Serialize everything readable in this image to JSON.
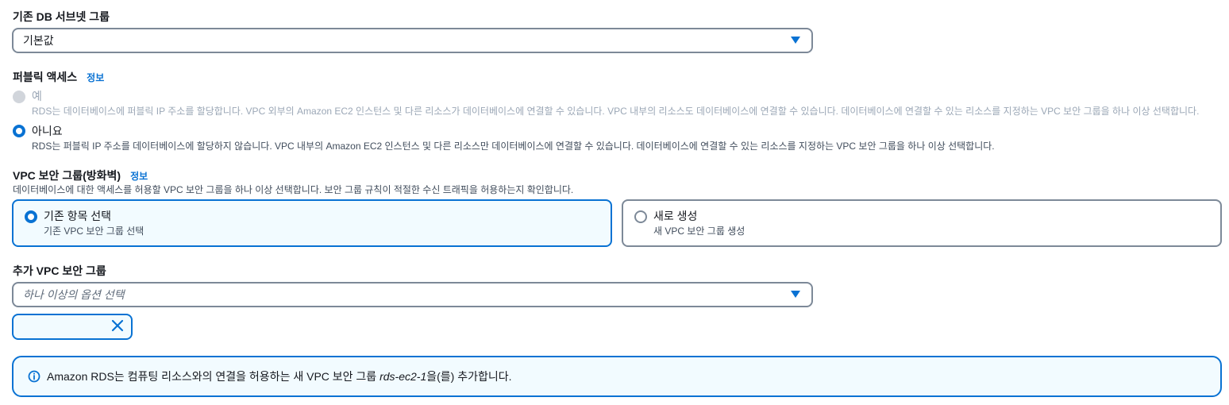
{
  "subnet_group": {
    "label": "기존 DB 서브넷 그룹",
    "value": "기본값"
  },
  "public_access": {
    "label": "퍼블릭 액세스",
    "info": "정보",
    "options": [
      {
        "label": "예",
        "description": "RDS는 데이터베이스에 퍼블릭 IP 주소를 할당합니다. VPC 외부의 Amazon EC2 인스턴스 및 다른 리소스가 데이터베이스에 연결할 수 있습니다. VPC 내부의 리소스도 데이터베이스에 연결할 수 있습니다. 데이터베이스에 연결할 수 있는 리소스를 지정하는 VPC 보안 그룹을 하나 이상 선택합니다.",
        "disabled": true
      },
      {
        "label": "아니요",
        "description": "RDS는 퍼블릭 IP 주소를 데이터베이스에 할당하지 않습니다. VPC 내부의 Amazon EC2 인스턴스 및 다른 리소스만 데이터베이스에 연결할 수 있습니다. 데이터베이스에 연결할 수 있는 리소스를 지정하는 VPC 보안 그룹을 하나 이상 선택합니다.",
        "selected": true
      }
    ]
  },
  "vpc_security_group": {
    "label": "VPC 보안 그룹(방화벽)",
    "info": "정보",
    "description": "데이터베이스에 대한 액세스를 허용할 VPC 보안 그룹을 하나 이상 선택합니다. 보안 그룹 규칙이 적절한 수신 트래픽을 허용하는지 확인합니다.",
    "tiles": [
      {
        "label": "기존 항목 선택",
        "description": "기존 VPC 보안 그룹 선택",
        "selected": true
      },
      {
        "label": "새로 생성",
        "description": "새 VPC 보안 그룹 생성",
        "selected": false
      }
    ]
  },
  "additional_groups": {
    "label": "추가 VPC 보안 그룹",
    "placeholder": "하나 이상의 옵션 선택",
    "token_value": ""
  },
  "alert": {
    "text_before": "Amazon RDS는 컴퓨팅 리소스와의 연결을 허용하는 새 VPC 보안 그룹 ",
    "group_name": "rds-ec2-1",
    "text_after": "을(를) 추가합니다."
  },
  "colors": {
    "accent": "#0972d3",
    "selected_bg": "#f2fbff",
    "border": "#7d8998",
    "disabled": "#9ba7b6"
  },
  "icons": [
    "caret-down-icon",
    "close-icon",
    "info-icon"
  ]
}
